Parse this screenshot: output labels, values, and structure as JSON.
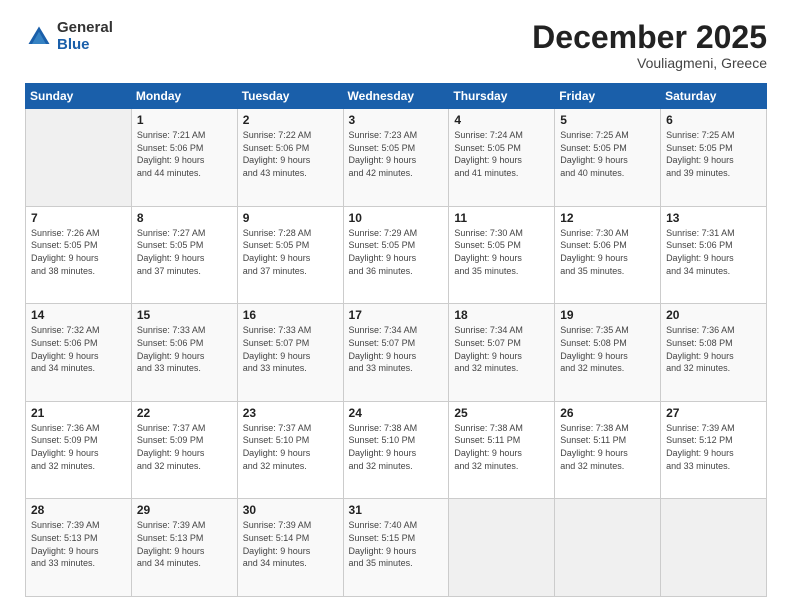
{
  "logo": {
    "general": "General",
    "blue": "Blue"
  },
  "header": {
    "month": "December 2025",
    "location": "Vouliagmeni, Greece"
  },
  "weekdays": [
    "Sunday",
    "Monday",
    "Tuesday",
    "Wednesday",
    "Thursday",
    "Friday",
    "Saturday"
  ],
  "weeks": [
    [
      {
        "day": "",
        "info": ""
      },
      {
        "day": "1",
        "info": "Sunrise: 7:21 AM\nSunset: 5:06 PM\nDaylight: 9 hours\nand 44 minutes."
      },
      {
        "day": "2",
        "info": "Sunrise: 7:22 AM\nSunset: 5:06 PM\nDaylight: 9 hours\nand 43 minutes."
      },
      {
        "day": "3",
        "info": "Sunrise: 7:23 AM\nSunset: 5:05 PM\nDaylight: 9 hours\nand 42 minutes."
      },
      {
        "day": "4",
        "info": "Sunrise: 7:24 AM\nSunset: 5:05 PM\nDaylight: 9 hours\nand 41 minutes."
      },
      {
        "day": "5",
        "info": "Sunrise: 7:25 AM\nSunset: 5:05 PM\nDaylight: 9 hours\nand 40 minutes."
      },
      {
        "day": "6",
        "info": "Sunrise: 7:25 AM\nSunset: 5:05 PM\nDaylight: 9 hours\nand 39 minutes."
      }
    ],
    [
      {
        "day": "7",
        "info": "Sunrise: 7:26 AM\nSunset: 5:05 PM\nDaylight: 9 hours\nand 38 minutes."
      },
      {
        "day": "8",
        "info": "Sunrise: 7:27 AM\nSunset: 5:05 PM\nDaylight: 9 hours\nand 37 minutes."
      },
      {
        "day": "9",
        "info": "Sunrise: 7:28 AM\nSunset: 5:05 PM\nDaylight: 9 hours\nand 37 minutes."
      },
      {
        "day": "10",
        "info": "Sunrise: 7:29 AM\nSunset: 5:05 PM\nDaylight: 9 hours\nand 36 minutes."
      },
      {
        "day": "11",
        "info": "Sunrise: 7:30 AM\nSunset: 5:05 PM\nDaylight: 9 hours\nand 35 minutes."
      },
      {
        "day": "12",
        "info": "Sunrise: 7:30 AM\nSunset: 5:06 PM\nDaylight: 9 hours\nand 35 minutes."
      },
      {
        "day": "13",
        "info": "Sunrise: 7:31 AM\nSunset: 5:06 PM\nDaylight: 9 hours\nand 34 minutes."
      }
    ],
    [
      {
        "day": "14",
        "info": "Sunrise: 7:32 AM\nSunset: 5:06 PM\nDaylight: 9 hours\nand 34 minutes."
      },
      {
        "day": "15",
        "info": "Sunrise: 7:33 AM\nSunset: 5:06 PM\nDaylight: 9 hours\nand 33 minutes."
      },
      {
        "day": "16",
        "info": "Sunrise: 7:33 AM\nSunset: 5:07 PM\nDaylight: 9 hours\nand 33 minutes."
      },
      {
        "day": "17",
        "info": "Sunrise: 7:34 AM\nSunset: 5:07 PM\nDaylight: 9 hours\nand 33 minutes."
      },
      {
        "day": "18",
        "info": "Sunrise: 7:34 AM\nSunset: 5:07 PM\nDaylight: 9 hours\nand 32 minutes."
      },
      {
        "day": "19",
        "info": "Sunrise: 7:35 AM\nSunset: 5:08 PM\nDaylight: 9 hours\nand 32 minutes."
      },
      {
        "day": "20",
        "info": "Sunrise: 7:36 AM\nSunset: 5:08 PM\nDaylight: 9 hours\nand 32 minutes."
      }
    ],
    [
      {
        "day": "21",
        "info": "Sunrise: 7:36 AM\nSunset: 5:09 PM\nDaylight: 9 hours\nand 32 minutes."
      },
      {
        "day": "22",
        "info": "Sunrise: 7:37 AM\nSunset: 5:09 PM\nDaylight: 9 hours\nand 32 minutes."
      },
      {
        "day": "23",
        "info": "Sunrise: 7:37 AM\nSunset: 5:10 PM\nDaylight: 9 hours\nand 32 minutes."
      },
      {
        "day": "24",
        "info": "Sunrise: 7:38 AM\nSunset: 5:10 PM\nDaylight: 9 hours\nand 32 minutes."
      },
      {
        "day": "25",
        "info": "Sunrise: 7:38 AM\nSunset: 5:11 PM\nDaylight: 9 hours\nand 32 minutes."
      },
      {
        "day": "26",
        "info": "Sunrise: 7:38 AM\nSunset: 5:11 PM\nDaylight: 9 hours\nand 32 minutes."
      },
      {
        "day": "27",
        "info": "Sunrise: 7:39 AM\nSunset: 5:12 PM\nDaylight: 9 hours\nand 33 minutes."
      }
    ],
    [
      {
        "day": "28",
        "info": "Sunrise: 7:39 AM\nSunset: 5:13 PM\nDaylight: 9 hours\nand 33 minutes."
      },
      {
        "day": "29",
        "info": "Sunrise: 7:39 AM\nSunset: 5:13 PM\nDaylight: 9 hours\nand 34 minutes."
      },
      {
        "day": "30",
        "info": "Sunrise: 7:39 AM\nSunset: 5:14 PM\nDaylight: 9 hours\nand 34 minutes."
      },
      {
        "day": "31",
        "info": "Sunrise: 7:40 AM\nSunset: 5:15 PM\nDaylight: 9 hours\nand 35 minutes."
      },
      {
        "day": "",
        "info": ""
      },
      {
        "day": "",
        "info": ""
      },
      {
        "day": "",
        "info": ""
      }
    ]
  ]
}
